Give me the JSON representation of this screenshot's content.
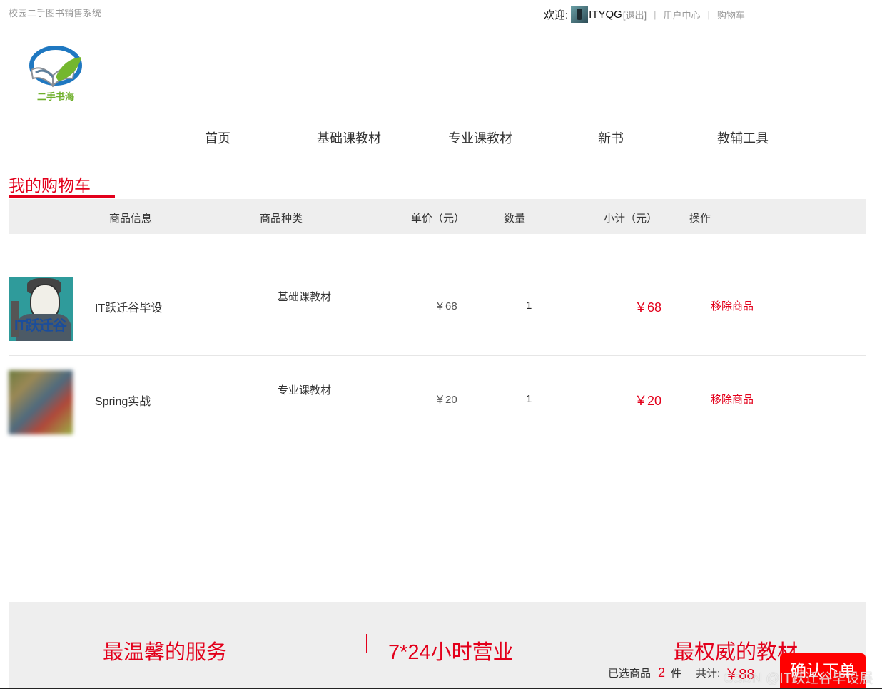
{
  "header": {
    "site_name": "校园二手图书销售系统",
    "welcome": "欢迎:",
    "username": "ITYQG",
    "logout": "[退出]",
    "user_center": "用户中心",
    "cart": "购物车",
    "logo_text": "二手书海"
  },
  "nav": {
    "items": [
      "首页",
      "基础课教材",
      "专业课教材",
      "新书",
      "教辅工具"
    ]
  },
  "cart": {
    "title": "我的购物车",
    "columns": [
      "商品信息",
      "商品种类",
      "单价（元）",
      "数量",
      "小计（元）",
      "操作"
    ],
    "rows": [
      {
        "thumb_text": "IT跃迁谷",
        "name": "IT跃迁谷毕设",
        "category": "基础课教材",
        "price": "￥68",
        "quantity": "1",
        "subtotal": "￥68",
        "action": "移除商品"
      },
      {
        "name": "Spring实战",
        "category": "专业课教材",
        "price": "￥20",
        "quantity": "1",
        "subtotal": "￥20",
        "action": "移除商品"
      }
    ]
  },
  "footer": {
    "features": [
      "最温馨的服务",
      "7*24小时营业",
      "最权威的教材"
    ]
  },
  "summary": {
    "selected_label": "已选商品",
    "selected_count": "2",
    "unit": "件",
    "total_label": "共计:",
    "total": "￥88",
    "confirm": "确认下单"
  },
  "watermark": "CSDN @IT跃迁谷毕设展",
  "colors": {
    "accent": "#e3001b",
    "button": "#ff0000",
    "header_bg": "#eeeeee"
  }
}
